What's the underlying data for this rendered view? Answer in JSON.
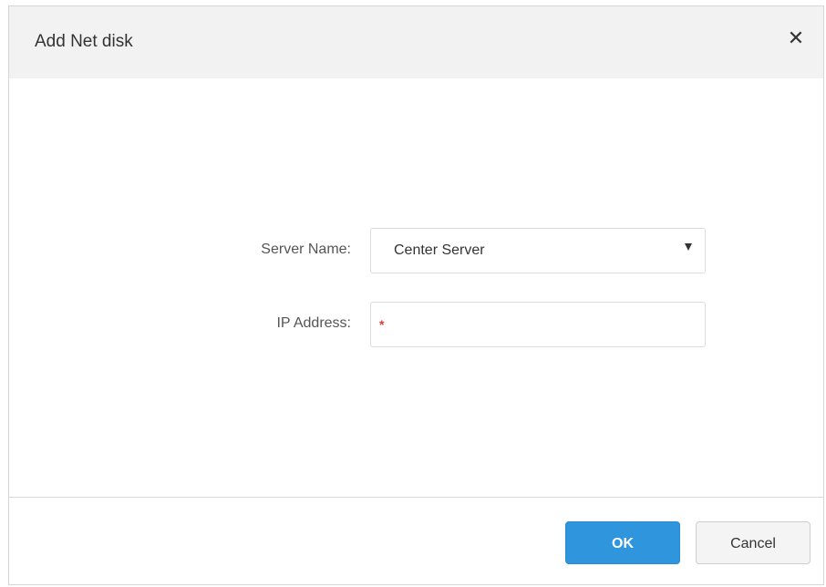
{
  "dialog": {
    "title": "Add Net disk",
    "close_glyph": "✕"
  },
  "form": {
    "server_name": {
      "label": "Server Name:",
      "selected": "Center Server"
    },
    "ip_address": {
      "label": "IP Address:",
      "value": "",
      "required_marker": "*"
    }
  },
  "footer": {
    "ok_label": "OK",
    "cancel_label": "Cancel"
  },
  "colors": {
    "header_bg": "#f2f2f2",
    "primary": "#2f95dc",
    "required": "#e53935"
  },
  "icons": {
    "close": "close-icon",
    "dropdown": "chevron-down-icon"
  }
}
